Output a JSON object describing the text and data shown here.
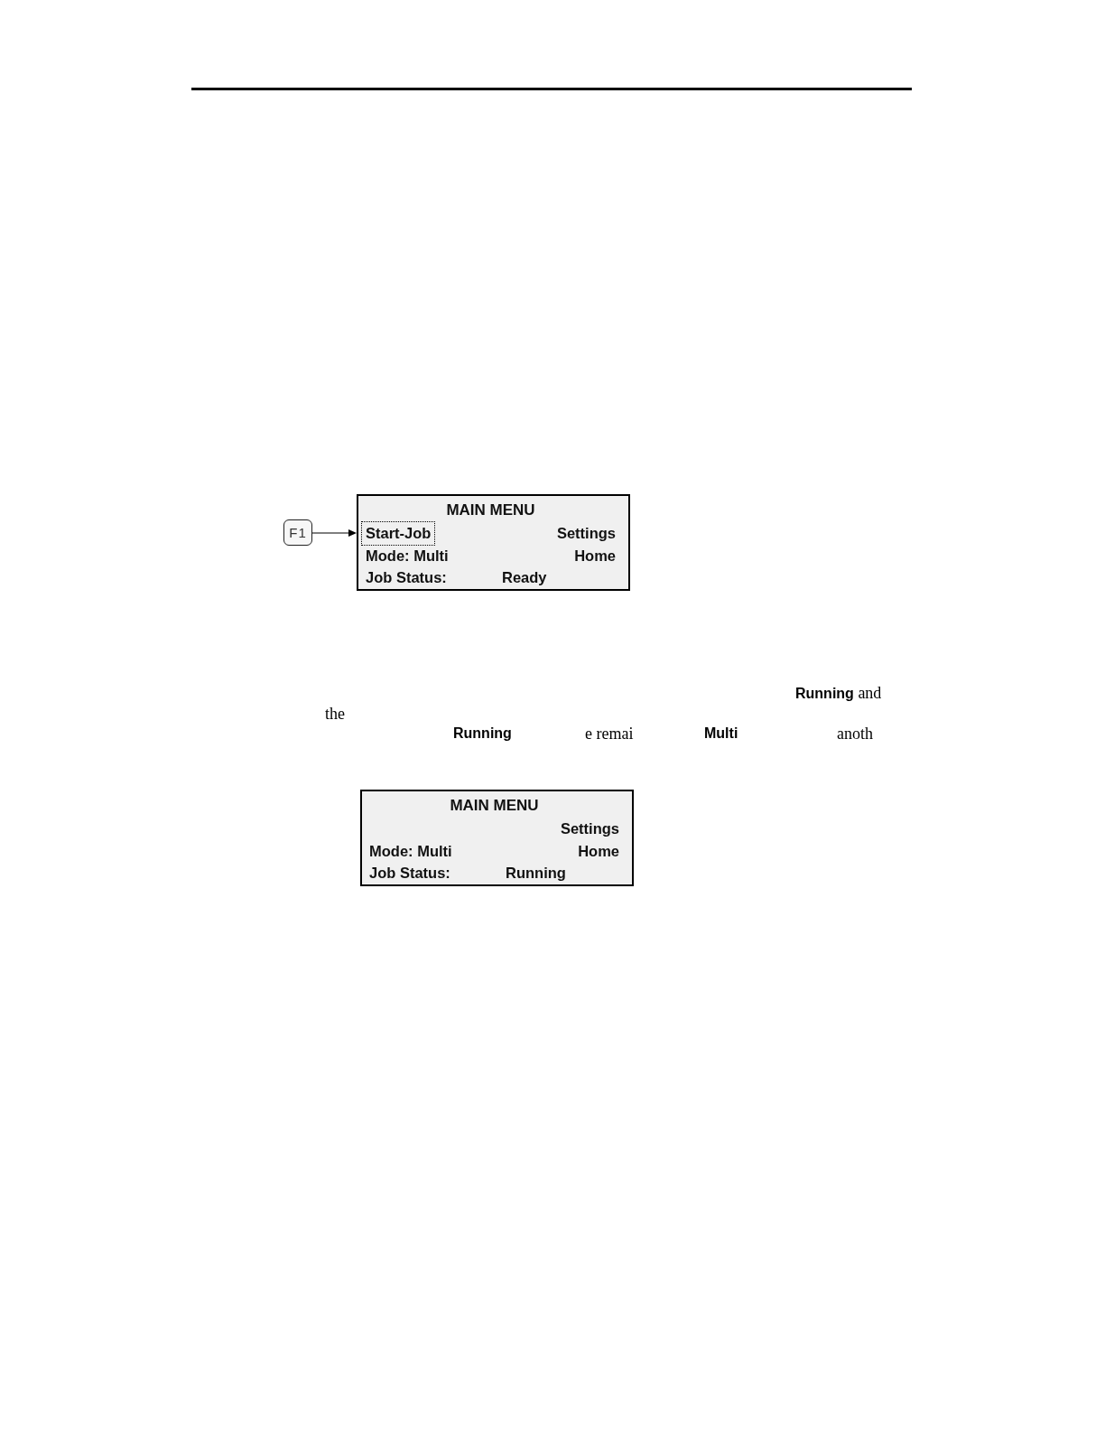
{
  "content": [
    {
      "kind": "figure",
      "key": {
        "label": "F1"
      },
      "screen": {
        "title": "MAIN MENU",
        "menu_left": {
          "label": "Start-Job",
          "selected": true
        },
        "menu_right": "Settings",
        "mode": "Mode: Multi",
        "home": "Home",
        "status_label": "Job Status:",
        "status_value": "Ready"
      }
    },
    {
      "kind": "paragraph",
      "lines": [
        {
          "fragments": [
            {
              "kind": "body",
              "text": "**Running** and"
            }
          ]
        },
        {
          "fragments": [
            {
              "kind": "body",
              "text": "the"
            }
          ]
        },
        {
          "fragments": [
            {
              "kind": "term",
              "text": "Running"
            },
            {
              "kind": "body",
              "text": "e remai"
            },
            {
              "kind": "term",
              "text": "Multi"
            },
            {
              "kind": "body",
              "text": "anoth"
            }
          ]
        }
      ]
    },
    {
      "kind": "figure",
      "screen": {
        "title": "MAIN MENU",
        "menu_right": "Settings",
        "mode": "Mode: Multi",
        "home": "Home",
        "status_label": "Job Status:",
        "status_value": "Running"
      }
    }
  ]
}
